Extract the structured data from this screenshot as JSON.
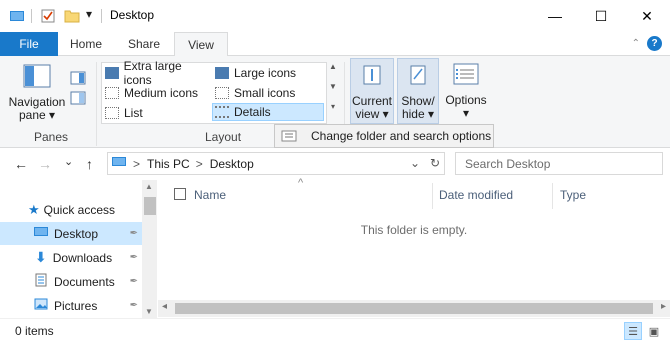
{
  "window": {
    "title": "Desktop",
    "minimize_glyph": "—",
    "maximize_glyph": "☐",
    "close_glyph": "✕"
  },
  "qat": {
    "dropdown_glyph": "▾"
  },
  "ribbon_tabs": {
    "file": "File",
    "home": "Home",
    "share": "Share",
    "view": "View",
    "collapse_glyph": "⌃",
    "help_glyph": "?"
  },
  "ribbon": {
    "panes": {
      "navigation_pane": "Navigation\npane",
      "navigation_pane_l1": "Navigation",
      "navigation_pane_l2": "pane ▾",
      "group_label": "Panes"
    },
    "layout": {
      "items": [
        "Extra large icons",
        "Large icons",
        "Medium icons",
        "Small icons",
        "List",
        "Details"
      ],
      "selected": "Details",
      "group_label": "Layout"
    },
    "current_view": {
      "l1": "Current",
      "l2": "view ▾"
    },
    "show_hide": {
      "l1": "Show/",
      "l2": "hide ▾"
    },
    "options": {
      "l1": "Options",
      "l2": "▾"
    }
  },
  "tooltip": {
    "text": "Change folder and search options"
  },
  "address": {
    "back_glyph": "←",
    "forward_glyph": "→",
    "recent_glyph": "⌄",
    "up_glyph": "↑",
    "path": [
      "This PC",
      "Desktop"
    ],
    "sep_glyph": ">",
    "dropdown_glyph": "⌄",
    "refresh_glyph": "↻",
    "search_placeholder": "Search Desktop"
  },
  "nav_pane": {
    "items": [
      {
        "label": "Quick access",
        "icon": "star-icon",
        "pinned": false
      },
      {
        "label": "Desktop",
        "icon": "desktop-icon",
        "pinned": true
      },
      {
        "label": "Downloads",
        "icon": "download-icon",
        "pinned": true
      },
      {
        "label": "Documents",
        "icon": "document-icon",
        "pinned": true
      },
      {
        "label": "Pictures",
        "icon": "pictures-icon",
        "pinned": true
      }
    ],
    "pin_glyph": "📌"
  },
  "content": {
    "columns": [
      "Name",
      "Date modified",
      "Type"
    ],
    "sort_glyph": "^",
    "empty_message": "This folder is empty.",
    "scroll_left_glyph": "◂",
    "scroll_right_glyph": "▸"
  },
  "status": {
    "item_count": "0 items"
  },
  "colors": {
    "accent": "#1979ca",
    "selection": "#cce8ff",
    "ribbon_bg": "#f5f6f7"
  }
}
